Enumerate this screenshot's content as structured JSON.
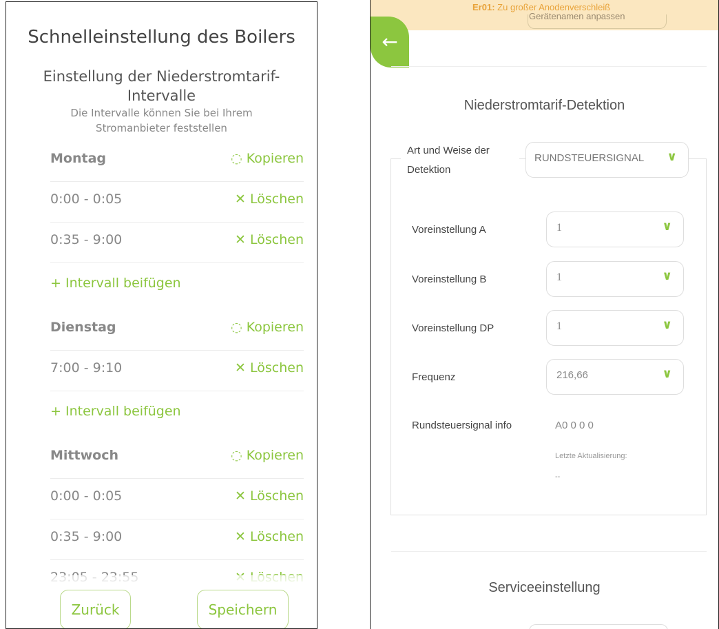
{
  "left": {
    "title": "Schnelleinstellung des Boilers",
    "subtitle_line1": "Einstellung der Niederstromtarif-",
    "subtitle_line2": "Intervalle",
    "hint_line1": "Die Intervalle können Sie bei Ihrem",
    "hint_line2": "Stromanbieter feststellen",
    "copy_label": "Kopieren",
    "delete_label": "Löschen",
    "add_label": "Intervall beifügen",
    "days": [
      {
        "name": "Montag",
        "intervals": [
          "0:00 - 0:05",
          "0:35 - 9:00"
        ]
      },
      {
        "name": "Dienstag",
        "intervals": [
          "7:00 - 9:10"
        ]
      },
      {
        "name": "Mittwoch",
        "intervals": [
          "0:00 - 0:05",
          "0:35 - 9:00",
          "23:05 - 23:55"
        ]
      }
    ],
    "back_button": "Zurück",
    "save_button": "Speichern"
  },
  "right": {
    "error_code": "Er01:",
    "error_text": "Zu großer Anodenverschleiß",
    "rename_text": "Gerätenamen anpassen",
    "section_title": "Niederstromtarif-Detektion",
    "detection_label_line1": "Art und Weise der",
    "detection_label_line2": "Detektion",
    "detection_value": "RUNDSTEUERSIGNAL",
    "fields": [
      {
        "label": "Voreinstellung A",
        "value": "1"
      },
      {
        "label": "Voreinstellung B",
        "value": "1"
      },
      {
        "label": "Voreinstellung DP",
        "value": "1"
      },
      {
        "label": "Frequenz",
        "value": "216,66"
      }
    ],
    "info_label": "Rundsteuersignal info",
    "info_value": "A0 0 0 0",
    "last_update_label": "Letzte Aktualisierung:",
    "last_update_value": "--",
    "service_title": "Serviceeinstellung"
  },
  "colors": {
    "accent": "#8cc63f",
    "warning_bg": "#fbe7c0",
    "error_text": "#e8a33a"
  },
  "icons": {
    "copy": "copy-icon",
    "delete": "close-icon",
    "add": "plus-icon",
    "back": "arrow-left-icon",
    "dropdown": "chevron-down-icon"
  }
}
